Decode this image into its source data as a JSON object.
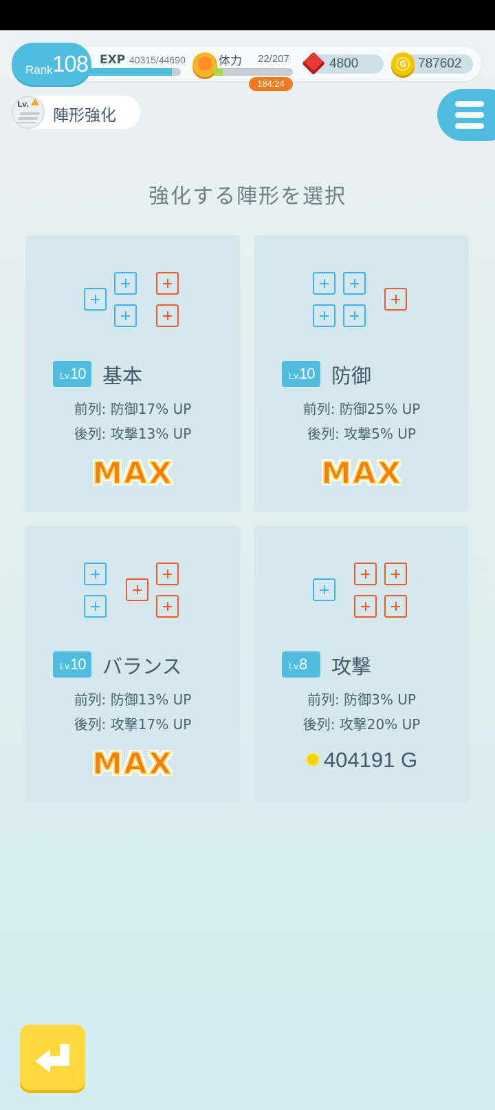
{
  "hud": {
    "rank_label": "Rank",
    "rank_value": "108",
    "exp_label": "EXP",
    "exp_value": "40315/44690",
    "exp_progress": 0.902,
    "stamina_label": "体力",
    "stamina_value": "22/207",
    "stamina_progress": 0.106,
    "stamina_timer": "184:24",
    "gems": "4800",
    "coins": "787602",
    "stamina_icon": "flexed-arm-icon",
    "gem_icon": "red-gem-icon",
    "coin_icon": "gold-coin-icon"
  },
  "header": {
    "title": "陣形強化",
    "title_icon_text": "Lv.",
    "title_icon": "level-up-icon",
    "menu_icon": "hamburger-menu-icon"
  },
  "section_title": "強化する陣形を選択",
  "formations": [
    {
      "lv_prefix": "Lv.",
      "level": "10",
      "name": "基本",
      "front": "前列: 防御17% UP",
      "back": "後列: 攻撃13% UP",
      "status": "MAX"
    },
    {
      "lv_prefix": "Lv.",
      "level": "10",
      "name": "防御",
      "front": "前列: 防御25% UP",
      "back": "後列: 攻撃5% UP",
      "status": "MAX"
    },
    {
      "lv_prefix": "Lv.",
      "level": "10",
      "name": "バランス",
      "front": "前列: 防御13% UP",
      "back": "後列: 攻撃17% UP",
      "status": "MAX"
    },
    {
      "lv_prefix": "Lv.",
      "level": "8",
      "name": "攻撃",
      "front": "前列: 防御3% UP",
      "back": "後列: 攻撃20% UP",
      "cost": "404191 G"
    }
  ],
  "footer": {
    "back_icon": "return-arrow-icon"
  },
  "colors": {
    "accent_blue": "#4fbde0",
    "front_slot": "#3fb6e6",
    "back_slot": "#ee5a2b",
    "back_button": "#ffd93b",
    "timer": "#f47a1f"
  }
}
